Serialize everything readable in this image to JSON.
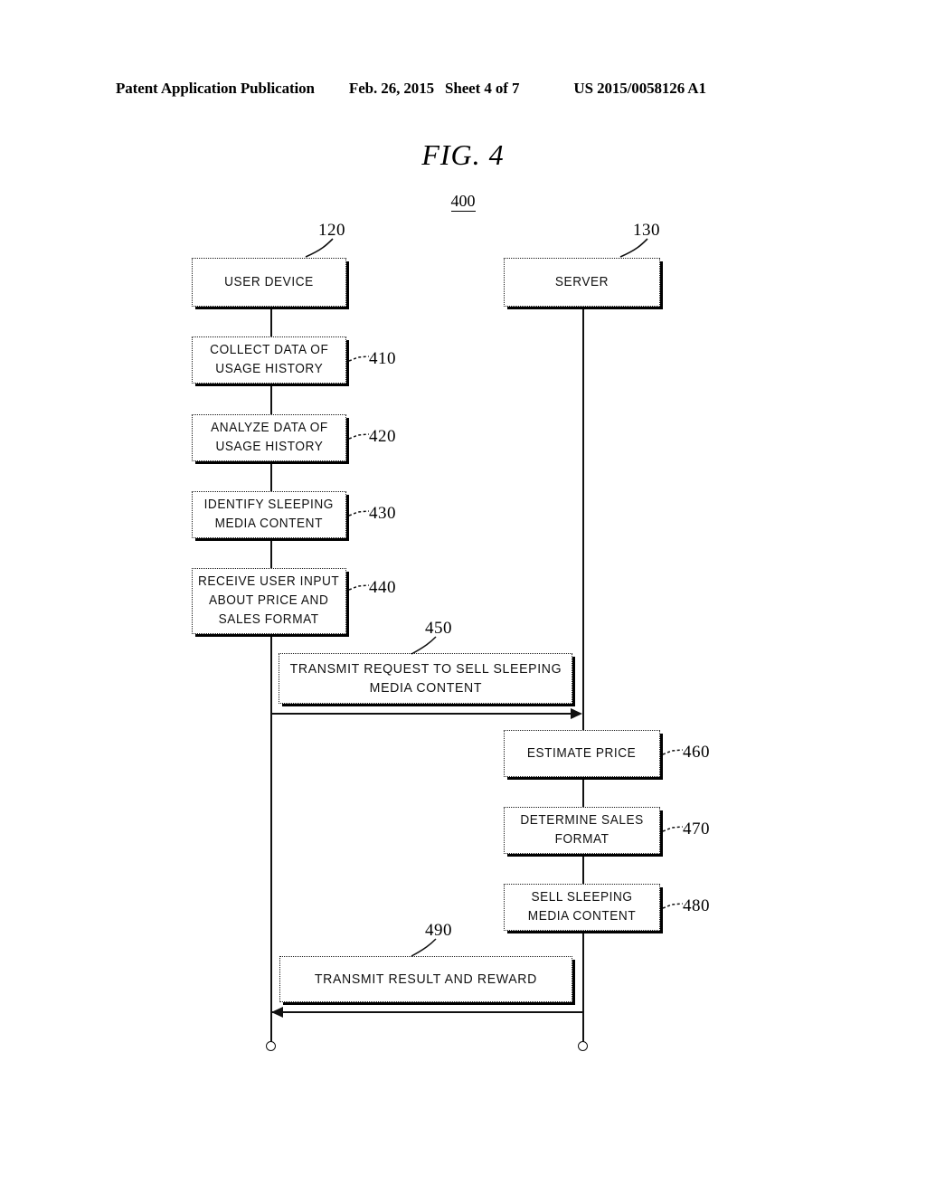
{
  "header": {
    "publication": "Patent Application Publication",
    "date": "Feb. 26, 2015",
    "sheet": "Sheet 4 of 7",
    "patent_number": "US 2015/0058126 A1"
  },
  "figure": {
    "title": "FIG. 4",
    "number": "400"
  },
  "lifelines": [
    {
      "ref": "120",
      "label": "USER DEVICE"
    },
    {
      "ref": "130",
      "label": "SERVER"
    }
  ],
  "steps": [
    {
      "ref": "410",
      "label": "COLLECT DATA OF\nUSAGE HISTORY",
      "lane": "user"
    },
    {
      "ref": "420",
      "label": "ANALYZE DATA OF\nUSAGE HISTORY",
      "lane": "user"
    },
    {
      "ref": "430",
      "label": "IDENTIFY SLEEPING\nMEDIA CONTENT",
      "lane": "user"
    },
    {
      "ref": "440",
      "label": "RECEIVE USER INPUT\nABOUT PRICE AND\nSALES FORMAT",
      "lane": "user"
    },
    {
      "ref": "460",
      "label": "ESTIMATE PRICE",
      "lane": "server"
    },
    {
      "ref": "470",
      "label": "DETERMINE SALES\nFORMAT",
      "lane": "server"
    },
    {
      "ref": "480",
      "label": "SELL SLEEPING\nMEDIA CONTENT",
      "lane": "server"
    }
  ],
  "messages": [
    {
      "ref": "450",
      "label": "TRANSMIT REQUEST TO SELL SLEEPING\nMEDIA CONTENT",
      "direction": "user-to-server"
    },
    {
      "ref": "490",
      "label": "TRANSMIT RESULT AND REWARD",
      "direction": "server-to-user"
    }
  ]
}
